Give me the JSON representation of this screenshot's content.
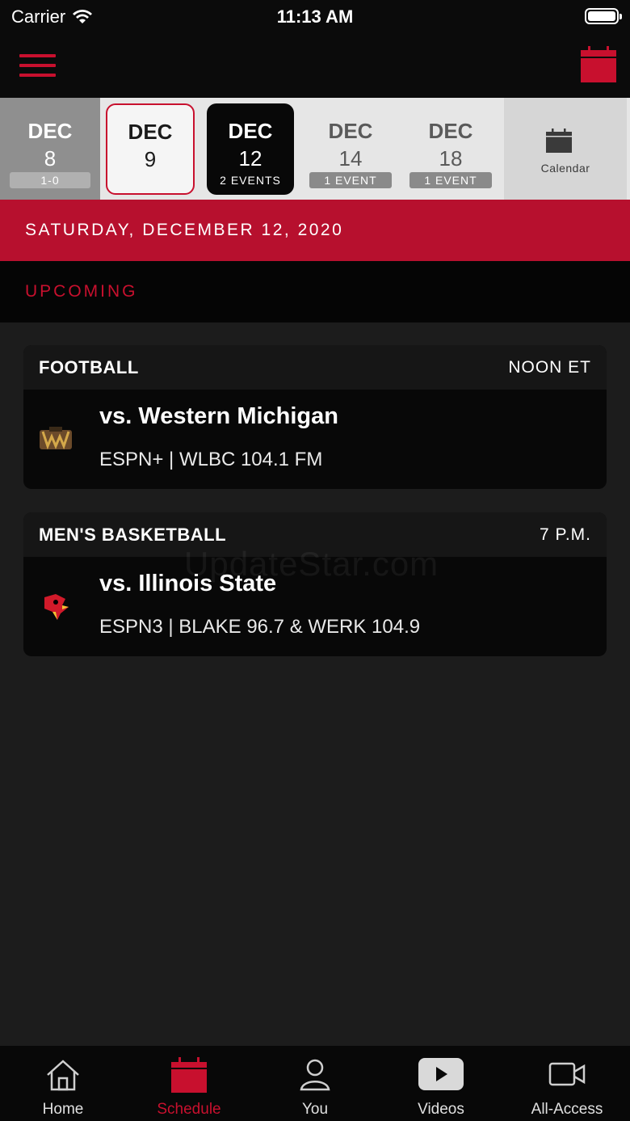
{
  "status_bar": {
    "carrier": "Carrier",
    "time": "11:13 AM"
  },
  "colors": {
    "accent": "#c8102e",
    "banner": "#b7102e",
    "background": "#1c1c1c"
  },
  "date_strip": {
    "days": [
      {
        "month": "DEC",
        "day": "8",
        "badge": "1-0"
      },
      {
        "month": "DEC",
        "day": "9"
      },
      {
        "month": "DEC",
        "day": "12",
        "badge": "2 EVENTS",
        "selected": true
      },
      {
        "month": "DEC",
        "day": "14",
        "badge": "1 EVENT"
      },
      {
        "month": "DEC",
        "day": "18",
        "badge": "1 EVENT"
      }
    ],
    "calendar_label": "Calendar"
  },
  "date_banner": "SATURDAY, DECEMBER 12, 2020",
  "section_label": "UPCOMING",
  "events": [
    {
      "sport": "FOOTBALL",
      "time": "NOON ET",
      "opponent": "vs. Western Michigan",
      "broadcast": "ESPN+ | WLBC 104.1 FM",
      "logo_icon": "western-michigan-bronco-logo"
    },
    {
      "sport": "MEN'S BASKETBALL",
      "time": "7 P.M.",
      "opponent": "vs. Illinois State",
      "broadcast": "ESPN3 | BLAKE 96.7 & WERK 104.9",
      "logo_icon": "illinois-state-redbird-logo"
    }
  ],
  "watermark": "UpdateStar.com",
  "tabs": [
    {
      "label": "Home",
      "icon": "home-icon"
    },
    {
      "label": "Schedule",
      "icon": "calendar-icon",
      "active": true
    },
    {
      "label": "You",
      "icon": "person-icon"
    },
    {
      "label": "Videos",
      "icon": "play-icon"
    },
    {
      "label": "All-Access",
      "icon": "video-camera-icon"
    }
  ]
}
